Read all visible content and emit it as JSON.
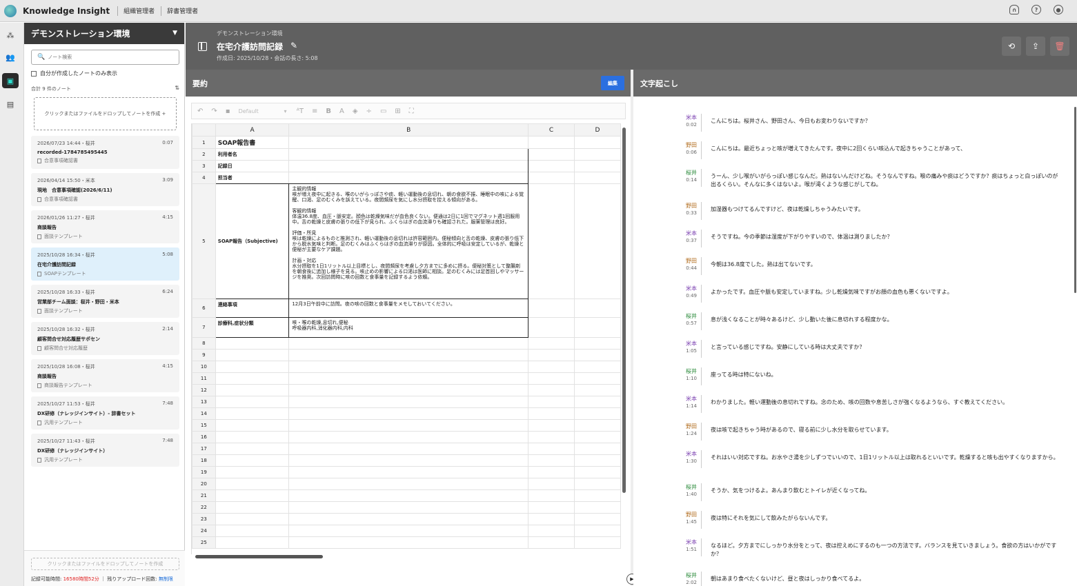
{
  "topbar": {
    "app_title": "Knowledge Insight",
    "links": [
      "組織管理者",
      "辞書管理者"
    ]
  },
  "sidebar": {
    "workspace": "デモンストレーション環境",
    "search_placeholder": "ノート検索",
    "only_mine_label": "自分が作成したノートのみ表示",
    "count_label": "合計 9 件のノート",
    "dropzone_label": "クリックまたはファイルをドロップしてノートを作成 +",
    "notes": [
      {
        "date": "2026/07/23 14:44・桜井",
        "duration": "0:07",
        "title": "recorded-1784785495445",
        "template": "合意事項確認書"
      },
      {
        "date": "2026/04/14 15:50・米本",
        "duration": "3:09",
        "title": "現地　合意事項確認(2026/6/11)",
        "template": "合意事項確認書"
      },
      {
        "date": "2026/01/26 11:27・桜井",
        "duration": "4:15",
        "title": "商談報告",
        "template": "面談テンプレート"
      },
      {
        "date": "2025/10/28 16:34・桜井",
        "duration": "5:08",
        "title": "在宅介護訪問記録",
        "template": "SOAPテンプレート"
      },
      {
        "date": "2025/10/28 16:33・桜井",
        "duration": "6:24",
        "title": "営業部チーム面談：桜井・野田・米本",
        "template": "面談テンプレート"
      },
      {
        "date": "2025/10/28 16:32・桜井",
        "duration": "2:14",
        "title": "顧客問合せ対応履歴サポセン",
        "template": "顧客問合せ対応履歴"
      },
      {
        "date": "2025/10/28 16:08・桜井",
        "duration": "4:15",
        "title": "商談報告",
        "template": "商談報告テンプレート"
      },
      {
        "date": "2025/10/27 11:53・桜井",
        "duration": "7:48",
        "title": "DX研修（ナレッジインサイト）- 辞書セット",
        "template": "汎用テンプレート"
      },
      {
        "date": "2025/10/27 11:43・桜井",
        "duration": "7:48",
        "title": "DX研修（ナレッジインサイト）",
        "template": "汎用テンプレート"
      }
    ],
    "footer_dropzone": "クリックまたはファイルをドロップしてノートを作成",
    "quota_label": "記録可能時間:",
    "quota_value": "16580時間52分",
    "uploads_label": "残りアップロード回数:",
    "uploads_value": "無制限"
  },
  "header": {
    "workspace": "デモンストレーション環境",
    "title": "在宅介護訪問記録",
    "meta": "作成日: 2025/10/28・会話の長さ: 5:08"
  },
  "summary": {
    "title": "要約",
    "edit_label": "編集",
    "font_placeholder": "Default",
    "columns": [
      "A",
      "B",
      "C",
      "D"
    ],
    "row_numbers": [
      "1",
      "2",
      "3",
      "4",
      "5",
      "6",
      "7",
      "8",
      "9",
      "10",
      "11",
      "12",
      "13",
      "14",
      "15",
      "16",
      "17",
      "18",
      "19",
      "20",
      "21",
      "22",
      "23",
      "24",
      "25"
    ],
    "sheet_title": "SOAP報告書",
    "labels": {
      "user": "利用者名",
      "date": "記録日",
      "staff": "担当者",
      "soap": "SOAP報告（Subjective)",
      "contact": "連絡事項",
      "dept": "診療科,症状分類"
    },
    "soap_paragraphs": [
      "主観的情報\n咳が増え夜中に起きる、喉のいがらっぽさや痰、軽い運動後の息切れ、朝の食欲不振、睡眠中の咳による覚醒、口渇、足のむくみを訴えている。夜間頻尿を気にし水分摂取を控える傾向がある。",
      "客観的情報\n体温36.8度、血圧・脈安定。顔色は乾燥気味だが血色良くない。便通は2日に1回でマグネット週1回服用中。舌の乾燥と皮膚の張りの低下が見られ、ふくらはぎの血流滞りも確認された。服薬管理は良好。",
      "評価・所見\n咳は乾燥によるものと推測され、軽い運動後の息切れは許容範囲内。便秘傾向と舌の乾燥、皮膚の張り低下から脱水気味と判断。足のむくみはふくらはぎの血流滞りが原因。全体的に呼吸は安定しているが、乾燥と便秘が主要なケア課題。",
      "計画・対応\n水分摂取を1日1リットル以上目標とし、夜間頻尿を考慮し夕方までに多めに摂る。便秘対策として整腸剤を朝食後に追加し様子を見る。咳止めの影響による口渇は医師に相談。足のむくみには足首回しやマッサージを推奨。次回訪問時に咳の回数と食事量を記録するよう依頼。"
    ],
    "contact_text": "12月3日午前中に訪問。夜の咳の回数と食事量をメモしておいてください。",
    "dept_text": "咳・喉の乾燥,息切れ,便秘\n呼吸器内科,消化器内科,内科"
  },
  "transcript": {
    "title": "文字起こし",
    "colors": {
      "米本": "#7a3fb0",
      "野田": "#b06a1a",
      "桜井": "#2a8a3a"
    },
    "items": [
      {
        "speaker": "米本",
        "time": "0:02",
        "text": "こんにちは。桜井さん、野田さん、今日もお変わりないですか？"
      },
      {
        "speaker": "野田",
        "time": "0:06",
        "text": "こんにちは。最近ちょっと咳が増えてきたんです。夜中に2回くらい咳込んで起きちゃうことがあって、"
      },
      {
        "speaker": "桜井",
        "time": "0:14",
        "text": "うーん、少し喉がいがらっぽい感じなんだ。熱はないんだけどね。そうなんですね。喉の痛みや痰はどうですか？痰はちょっと白っぽいのが出るくらい。そんなに多くはないよ。喉が渇くような感じがしてね。"
      },
      {
        "speaker": "野田",
        "time": "0:33",
        "text": "加湿器もつけてるんですけど、夜は乾燥しちゃうみたいです。"
      },
      {
        "speaker": "米本",
        "time": "0:37",
        "text": "そうですね。今の季節は湿度が下がりやすいので、体温は測りましたか？"
      },
      {
        "speaker": "野田",
        "time": "0:44",
        "text": "今朝は36.8度でした。熱は出てないです。"
      },
      {
        "speaker": "米本",
        "time": "0:49",
        "text": "よかったです。血圧や脈も安定していますね。少し乾燥気味ですがお顔の血色も悪くないですよ。"
      },
      {
        "speaker": "桜井",
        "time": "0:57",
        "text": "息が浅くなることが時々あるけど、少し動いた後に息切れする程度かな。"
      },
      {
        "speaker": "米本",
        "time": "1:05",
        "text": "と言っている感じですね。安静にしている時は大丈夫ですか？"
      },
      {
        "speaker": "桜井",
        "time": "1:10",
        "text": "座ってる時は特にないね。"
      },
      {
        "speaker": "米本",
        "time": "1:14",
        "text": "わかりました。軽い運動後の息切れですね。念のため、咳の回数や息苦しさが強くなるようなら、すぐ教えてください。"
      },
      {
        "speaker": "野田",
        "time": "1:24",
        "text": "夜は咳で起きちゃう時があるので、寝る前に少し水分を取らせています。"
      },
      {
        "speaker": "米本",
        "time": "1:30",
        "text": "それはいい対応ですね。お水やさ湯を少しずつでいいので、1日1リットル以上は取れるといいです。乾燥すると咳も出やすくなりますから。"
      },
      {
        "speaker": "桜井",
        "time": "1:40",
        "text": "そうか、気をつけるよ。あんまり飲むとトイレが近くなってね。"
      },
      {
        "speaker": "野田",
        "time": "1:45",
        "text": "夜は特にそれを気にして飲みたがらないんです。"
      },
      {
        "speaker": "米本",
        "time": "1:51",
        "text": "なるほど。夕方までにしっかり水分をとって、夜は控えめにするのも一つの方法です。バランスを見ていきましょう。食欲の方はいかがですか？"
      },
      {
        "speaker": "桜井",
        "time": "2:02",
        "text": "朝はあまり食べたくないけど、昼と夜はしっかり食べてるよ。"
      }
    ]
  }
}
